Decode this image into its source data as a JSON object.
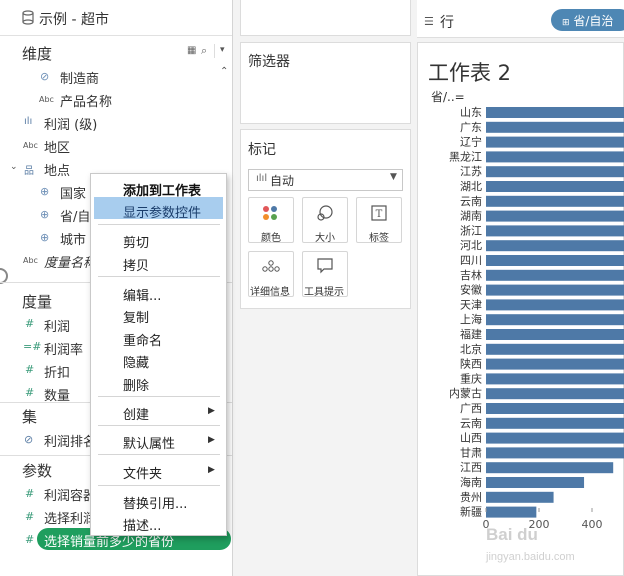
{
  "datasource": {
    "name": "示例 - 超市"
  },
  "dimensions": {
    "title": "维度",
    "fields": [
      {
        "name": "制造商",
        "type": "link"
      },
      {
        "name": "产品名称",
        "type": "abc"
      },
      {
        "name": "利润 (级)",
        "type": "bin"
      },
      {
        "name": "地区",
        "type": "abc"
      },
      {
        "name": "地点",
        "type": "hierarchy"
      },
      {
        "name": "国家",
        "type": "geo"
      },
      {
        "name": "省/自",
        "type": "geo"
      },
      {
        "name": "城市",
        "type": "geo"
      },
      {
        "name": "度量名称",
        "type": "abc"
      }
    ]
  },
  "measures": {
    "title": "度量",
    "fields": [
      {
        "name": "利润",
        "type": "hash"
      },
      {
        "name": "利润率",
        "type": "hash"
      },
      {
        "name": "折扣",
        "type": "hash"
      },
      {
        "name": "数量",
        "type": "hash"
      }
    ]
  },
  "sets": {
    "title": "集",
    "fields": [
      {
        "name": "利润排名"
      }
    ]
  },
  "parameters": {
    "title": "参数",
    "fields": [
      {
        "name": "利润容器"
      },
      {
        "name": "选择利润"
      },
      {
        "name": "选择销量前多少的省份"
      }
    ]
  },
  "context_menu": {
    "items": [
      {
        "label": "添加到工作表",
        "bold": true
      },
      {
        "label": "显示参数控件",
        "selected": true
      },
      {
        "label": "剪切"
      },
      {
        "label": "拷贝"
      },
      {
        "label": "编辑..."
      },
      {
        "label": "复制"
      },
      {
        "label": "重命名"
      },
      {
        "label": "隐藏"
      },
      {
        "label": "删除"
      },
      {
        "label": "创建",
        "submenu": true
      },
      {
        "label": "默认属性",
        "submenu": true
      },
      {
        "label": "文件夹",
        "submenu": true
      },
      {
        "label": "替换引用..."
      },
      {
        "label": "描述..."
      }
    ]
  },
  "filters": {
    "title": "筛选器"
  },
  "marks": {
    "title": "标记",
    "type_label": "自动",
    "buttons": [
      {
        "label": "颜色",
        "icon": "color-dots-icon"
      },
      {
        "label": "大小",
        "icon": "size-icon"
      },
      {
        "label": "标签",
        "icon": "text-label-icon"
      },
      {
        "label": "详细信息",
        "icon": "detail-dots-icon"
      },
      {
        "label": "工具提示",
        "icon": "tooltip-icon"
      }
    ]
  },
  "rows_shelf": {
    "label": "行",
    "pill": "省/自治"
  },
  "sheet": {
    "title": "工作表 2",
    "column_header": "省/..="
  },
  "chart_data": {
    "type": "bar",
    "orientation": "horizontal",
    "categories": [
      "山东",
      "广东",
      "辽宁",
      "黑龙江",
      "江苏",
      "湖北",
      "云南",
      "湖南",
      "浙江",
      "河北",
      "四川",
      "吉林",
      "安徽",
      "天津",
      "上海",
      "福建",
      "北京",
      "陕西",
      "重庆",
      "内蒙古",
      "广西",
      "云南",
      "山西",
      "甘肃",
      "江西",
      "海南",
      "贵州",
      "新疆"
    ],
    "values": [
      1100,
      1100,
      1100,
      1100,
      1100,
      1100,
      1100,
      1100,
      1100,
      1100,
      1100,
      1100,
      1100,
      1100,
      1100,
      1100,
      1100,
      1100,
      1100,
      1100,
      1100,
      1090,
      1080,
      1020,
      480,
      370,
      255,
      190
    ],
    "x_ticks": [
      "0",
      "200",
      "400"
    ],
    "bar_color": "#4e79a7"
  },
  "watermark": "jingyan.baidu.com"
}
